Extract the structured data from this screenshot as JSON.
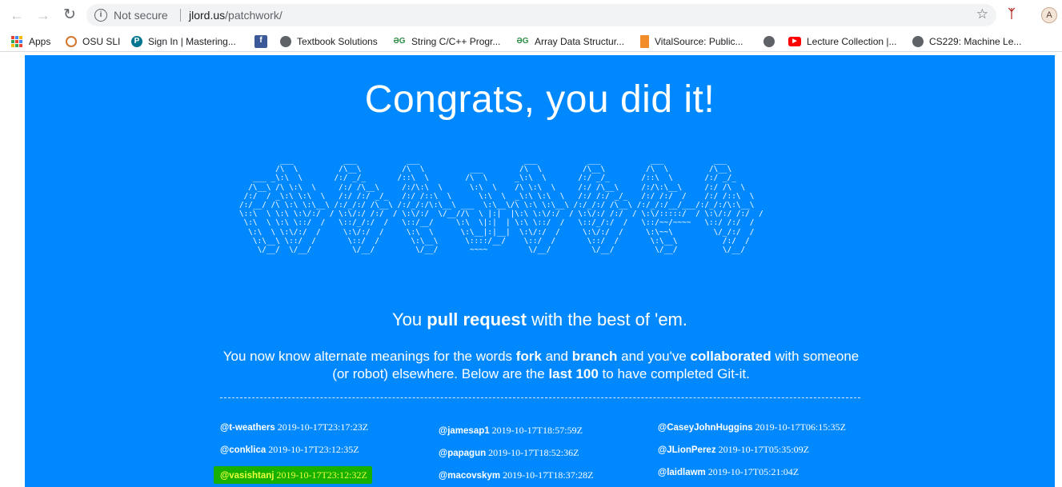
{
  "browser": {
    "security_label": "Not secure",
    "url_host": "jlord.us",
    "url_path": "/patchwork/",
    "avatar_initial": "A"
  },
  "bookmarks": [
    {
      "label": "Apps",
      "icon": "apps-grid-icon"
    },
    {
      "label": "OSU SLI",
      "icon": "osu-icon"
    },
    {
      "label": "Sign In | Mastering...",
      "icon": "pearson-icon"
    },
    {
      "label": "",
      "icon": "facebook-icon"
    },
    {
      "label": "Textbook Solutions",
      "icon": "globe-icon"
    },
    {
      "label": "String C/C++ Progr...",
      "icon": "geeksforgeeks-icon"
    },
    {
      "label": "Array Data Structur...",
      "icon": "geeksforgeeks-icon"
    },
    {
      "label": "VitalSource: Public...",
      "icon": "vitalsource-icon"
    },
    {
      "label": "",
      "icon": "globe-icon"
    },
    {
      "label": "Lecture Collection |...",
      "icon": "youtube-icon"
    },
    {
      "label": "CS229: Machine Le...",
      "icon": "globe-icon"
    }
  ],
  "page": {
    "title": "Congrats, you did it!",
    "tagline": {
      "pre": "You ",
      "bold": "pull request",
      "post": " with the best of 'em."
    },
    "desc": {
      "t1": "You now know alternate meanings for the words ",
      "b1": "fork",
      "t2": " and ",
      "b2": "branch",
      "t3": " and you've ",
      "b3": "collaborated",
      "t4": " with someone (or robot) elsewhere. Below are the ",
      "b4": "last 100",
      "t5": " to have completed Git-it."
    },
    "completions": [
      [
        {
          "user": "@t-weathers",
          "time": "2019-10-17T23:17:23Z"
        },
        {
          "user": "@conklica",
          "time": "2019-10-17T23:12:35Z"
        },
        {
          "user": "@vasishtanj",
          "time": "2019-10-17T23:12:32Z",
          "highlighted": true
        }
      ],
      [
        {
          "user": "@jamesap1",
          "time": "2019-10-17T18:57:59Z"
        },
        {
          "user": "@papagun",
          "time": "2019-10-17T18:52:36Z"
        },
        {
          "user": "@macovskym",
          "time": "2019-10-17T18:37:28Z"
        }
      ],
      [
        {
          "user": "@CaseyJohnHuggins",
          "time": "2019-10-17T06:15:35Z"
        },
        {
          "user": "@JLionPerez",
          "time": "2019-10-17T05:35:09Z"
        },
        {
          "user": "@laidlawm",
          "time": "2019-10-17T05:21:04Z"
        }
      ]
    ]
  },
  "colors": {
    "page_bg": "#0088ff",
    "highlight": "#18b000",
    "highlight_text": "#e8ff3a"
  }
}
